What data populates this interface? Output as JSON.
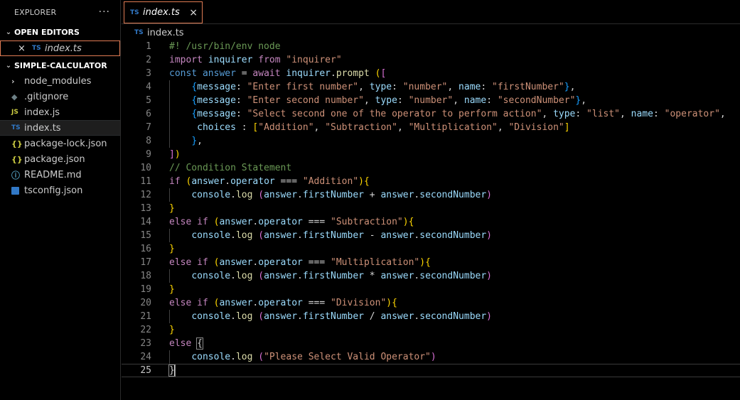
{
  "explorer": {
    "title": "EXPLORER",
    "more_label": "···",
    "open_editors": {
      "title": "OPEN EDITORS",
      "items": [
        {
          "label": "index.ts",
          "icon": "ts-file-icon"
        }
      ]
    },
    "folder": {
      "title": "SIMPLE-CALCULATOR",
      "items": [
        {
          "label": "node_modules",
          "icon": "chevron-right-icon"
        },
        {
          "label": ".gitignore",
          "icon": "git-file-icon"
        },
        {
          "label": "index.js",
          "icon": "js-file-icon"
        },
        {
          "label": "index.ts",
          "icon": "ts-file-icon",
          "selected": true
        },
        {
          "label": "package-lock.json",
          "icon": "json-file-icon"
        },
        {
          "label": "package.json",
          "icon": "json-file-icon"
        },
        {
          "label": "README.md",
          "icon": "info-icon"
        },
        {
          "label": "tsconfig.json",
          "icon": "tsconfig-icon"
        }
      ]
    }
  },
  "tab": {
    "label": "index.ts",
    "icon_text": "TS"
  },
  "breadcrumb": {
    "file": "index.ts",
    "icon_text": "TS"
  },
  "icon_text": {
    "ts": "TS",
    "js": "JS",
    "json": "{}",
    "info": "ⓘ",
    "git": "◆",
    "chevron_down": "⌄",
    "chevron_right": "›",
    "close": "×"
  },
  "colors": {
    "accent": "#e07b53",
    "ts": "#3178c6",
    "js": "#cbcb41"
  },
  "editor": {
    "active_line": 25,
    "lines": [
      [
        [
          "com",
          "#! /usr/bin/env node"
        ]
      ],
      [
        [
          "kw",
          "import"
        ],
        [
          "pun",
          " "
        ],
        [
          "var",
          "inquirer"
        ],
        [
          "pun",
          " "
        ],
        [
          "kw",
          "from"
        ],
        [
          "pun",
          " "
        ],
        [
          "str",
          "\"inquirer\""
        ]
      ],
      [
        [
          "decl",
          "const"
        ],
        [
          "pun",
          " "
        ],
        [
          "decl",
          "answer"
        ],
        [
          "pun",
          " = "
        ],
        [
          "kw",
          "await"
        ],
        [
          "pun",
          " "
        ],
        [
          "var",
          "inquirer"
        ],
        [
          "pun",
          "."
        ],
        [
          "fn",
          "prompt"
        ],
        [
          "pun",
          " "
        ],
        [
          "b1",
          "("
        ],
        [
          "b2",
          "["
        ]
      ],
      [
        [
          "pun",
          "    "
        ],
        [
          "b3",
          "{"
        ],
        [
          "var",
          "message"
        ],
        [
          "pun",
          ": "
        ],
        [
          "str",
          "\"Enter first number\""
        ],
        [
          "pun",
          ", "
        ],
        [
          "var",
          "type"
        ],
        [
          "pun",
          ": "
        ],
        [
          "str",
          "\"number\""
        ],
        [
          "pun",
          ", "
        ],
        [
          "var",
          "name"
        ],
        [
          "pun",
          ": "
        ],
        [
          "str",
          "\"firstNumber\""
        ],
        [
          "b3",
          "}"
        ],
        [
          "pun",
          ","
        ]
      ],
      [
        [
          "pun",
          "    "
        ],
        [
          "b3",
          "{"
        ],
        [
          "var",
          "message"
        ],
        [
          "pun",
          ": "
        ],
        [
          "str",
          "\"Enter second number\""
        ],
        [
          "pun",
          ", "
        ],
        [
          "var",
          "type"
        ],
        [
          "pun",
          ": "
        ],
        [
          "str",
          "\"number\""
        ],
        [
          "pun",
          ", "
        ],
        [
          "var",
          "name"
        ],
        [
          "pun",
          ": "
        ],
        [
          "str",
          "\"secondNumber\""
        ],
        [
          "b3",
          "}"
        ],
        [
          "pun",
          ","
        ]
      ],
      [
        [
          "pun",
          "    "
        ],
        [
          "b3",
          "{"
        ],
        [
          "var",
          "message"
        ],
        [
          "pun",
          ": "
        ],
        [
          "str",
          "\"Select second one of the operator to perform action\""
        ],
        [
          "pun",
          ", "
        ],
        [
          "var",
          "type"
        ],
        [
          "pun",
          ": "
        ],
        [
          "str",
          "\"list\""
        ],
        [
          "pun",
          ", "
        ],
        [
          "var",
          "name"
        ],
        [
          "pun",
          ": "
        ],
        [
          "str",
          "\"operator\""
        ],
        [
          "pun",
          ","
        ]
      ],
      [
        [
          "pun",
          "     "
        ],
        [
          "var",
          "choices"
        ],
        [
          "pun",
          " : "
        ],
        [
          "b1",
          "["
        ],
        [
          "str",
          "\"Addition\""
        ],
        [
          "pun",
          ", "
        ],
        [
          "str",
          "\"Subtraction\""
        ],
        [
          "pun",
          ", "
        ],
        [
          "str",
          "\"Multiplication\""
        ],
        [
          "pun",
          ", "
        ],
        [
          "str",
          "\"Division\""
        ],
        [
          "b1",
          "]"
        ]
      ],
      [
        [
          "pun",
          "    "
        ],
        [
          "b3",
          "}"
        ],
        [
          "pun",
          ","
        ]
      ],
      [
        [
          "b2",
          "]"
        ],
        [
          "b1",
          ")"
        ]
      ],
      [
        [
          "com",
          "// Condition Statement"
        ]
      ],
      [
        [
          "kw",
          "if"
        ],
        [
          "pun",
          " "
        ],
        [
          "b1",
          "("
        ],
        [
          "var",
          "answer"
        ],
        [
          "pun",
          "."
        ],
        [
          "var",
          "operator"
        ],
        [
          "pun",
          " === "
        ],
        [
          "str",
          "\"Addition\""
        ],
        [
          "b1",
          ")"
        ],
        [
          "b1",
          "{"
        ]
      ],
      [
        [
          "pun",
          "    "
        ],
        [
          "var",
          "console"
        ],
        [
          "pun",
          "."
        ],
        [
          "fn",
          "log"
        ],
        [
          "pun",
          " "
        ],
        [
          "b2",
          "("
        ],
        [
          "var",
          "answer"
        ],
        [
          "pun",
          "."
        ],
        [
          "var",
          "firstNumber"
        ],
        [
          "pun",
          " + "
        ],
        [
          "var",
          "answer"
        ],
        [
          "pun",
          "."
        ],
        [
          "var",
          "secondNumber"
        ],
        [
          "b2",
          ")"
        ]
      ],
      [
        [
          "b1",
          "}"
        ]
      ],
      [
        [
          "kw",
          "else"
        ],
        [
          "pun",
          " "
        ],
        [
          "kw",
          "if"
        ],
        [
          "pun",
          " "
        ],
        [
          "b1",
          "("
        ],
        [
          "var",
          "answer"
        ],
        [
          "pun",
          "."
        ],
        [
          "var",
          "operator"
        ],
        [
          "pun",
          " === "
        ],
        [
          "str",
          "\"Subtraction\""
        ],
        [
          "b1",
          ")"
        ],
        [
          "b1",
          "{"
        ]
      ],
      [
        [
          "pun",
          "    "
        ],
        [
          "var",
          "console"
        ],
        [
          "pun",
          "."
        ],
        [
          "fn",
          "log"
        ],
        [
          "pun",
          " "
        ],
        [
          "b2",
          "("
        ],
        [
          "var",
          "answer"
        ],
        [
          "pun",
          "."
        ],
        [
          "var",
          "firstNumber"
        ],
        [
          "pun",
          " - "
        ],
        [
          "var",
          "answer"
        ],
        [
          "pun",
          "."
        ],
        [
          "var",
          "secondNumber"
        ],
        [
          "b2",
          ")"
        ]
      ],
      [
        [
          "b1",
          "}"
        ]
      ],
      [
        [
          "kw",
          "else"
        ],
        [
          "pun",
          " "
        ],
        [
          "kw",
          "if"
        ],
        [
          "pun",
          " "
        ],
        [
          "b1",
          "("
        ],
        [
          "var",
          "answer"
        ],
        [
          "pun",
          "."
        ],
        [
          "var",
          "operator"
        ],
        [
          "pun",
          " === "
        ],
        [
          "str",
          "\"Multiplication\""
        ],
        [
          "b1",
          ")"
        ],
        [
          "b1",
          "{"
        ]
      ],
      [
        [
          "pun",
          "    "
        ],
        [
          "var",
          "console"
        ],
        [
          "pun",
          "."
        ],
        [
          "fn",
          "log"
        ],
        [
          "pun",
          " "
        ],
        [
          "b2",
          "("
        ],
        [
          "var",
          "answer"
        ],
        [
          "pun",
          "."
        ],
        [
          "var",
          "firstNumber"
        ],
        [
          "pun",
          " * "
        ],
        [
          "var",
          "answer"
        ],
        [
          "pun",
          "."
        ],
        [
          "var",
          "secondNumber"
        ],
        [
          "b2",
          ")"
        ]
      ],
      [
        [
          "b1",
          "}"
        ]
      ],
      [
        [
          "kw",
          "else"
        ],
        [
          "pun",
          " "
        ],
        [
          "kw",
          "if"
        ],
        [
          "pun",
          " "
        ],
        [
          "b1",
          "("
        ],
        [
          "var",
          "answer"
        ],
        [
          "pun",
          "."
        ],
        [
          "var",
          "operator"
        ],
        [
          "pun",
          " === "
        ],
        [
          "str",
          "\"Division\""
        ],
        [
          "b1",
          ")"
        ],
        [
          "b1",
          "{"
        ]
      ],
      [
        [
          "pun",
          "    "
        ],
        [
          "var",
          "console"
        ],
        [
          "pun",
          "."
        ],
        [
          "fn",
          "log"
        ],
        [
          "pun",
          " "
        ],
        [
          "b2",
          "("
        ],
        [
          "var",
          "answer"
        ],
        [
          "pun",
          "."
        ],
        [
          "var",
          "firstNumber"
        ],
        [
          "pun",
          " / "
        ],
        [
          "var",
          "answer"
        ],
        [
          "pun",
          "."
        ],
        [
          "var",
          "secondNumber"
        ],
        [
          "b2",
          ")"
        ]
      ],
      [
        [
          "b1",
          "}"
        ]
      ],
      [
        [
          "kw",
          "else"
        ],
        [
          "pun",
          " "
        ],
        [
          "bhl",
          "{"
        ]
      ],
      [
        [
          "pun",
          "    "
        ],
        [
          "var",
          "console"
        ],
        [
          "pun",
          "."
        ],
        [
          "fn",
          "log"
        ],
        [
          "pun",
          " "
        ],
        [
          "b2",
          "("
        ],
        [
          "str",
          "\"Please Select Valid Operator\""
        ],
        [
          "b2",
          ")"
        ]
      ],
      [
        [
          "bhl",
          "}"
        ]
      ]
    ]
  }
}
